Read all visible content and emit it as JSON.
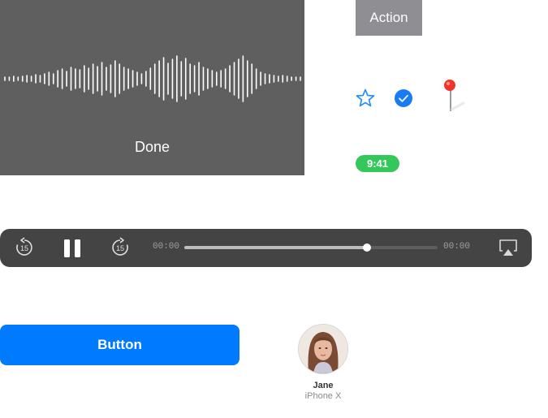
{
  "recorder": {
    "done_label": "Done",
    "background": "#5f5f5f",
    "waveform_levels": [
      2,
      2,
      3,
      2,
      3,
      4,
      3,
      5,
      4,
      6,
      8,
      6,
      10,
      12,
      9,
      14,
      12,
      11,
      16,
      13,
      18,
      15,
      20,
      14,
      17,
      22,
      18,
      14,
      12,
      10,
      8,
      6,
      9,
      13,
      18,
      22,
      26,
      19,
      24,
      28,
      21,
      25,
      18,
      16,
      20,
      14,
      12,
      10,
      8,
      10,
      12,
      16,
      20,
      24,
      28,
      22,
      18,
      12,
      8,
      6,
      5,
      4,
      3,
      4,
      3,
      2,
      2,
      2
    ]
  },
  "action_button": {
    "label": "Action",
    "color": "#8e8e93"
  },
  "icons": {
    "star": "star-outline-icon",
    "check": "checkmark-circle-icon",
    "pin": "map-pin-icon"
  },
  "time_badge": {
    "label": "9:41",
    "color": "#34c759"
  },
  "player": {
    "elapsed": "00:00",
    "remaining": "00:00",
    "progress": 0.72,
    "skip_back_label": "15",
    "skip_forward_label": "15",
    "controls": [
      "skip-back-15-icon",
      "pause-icon",
      "skip-forward-15-icon",
      "airplay-icon"
    ]
  },
  "primary_button": {
    "label": "Button",
    "color": "#007aff"
  },
  "contact": {
    "name": "Jane",
    "device": "iPhone X"
  }
}
